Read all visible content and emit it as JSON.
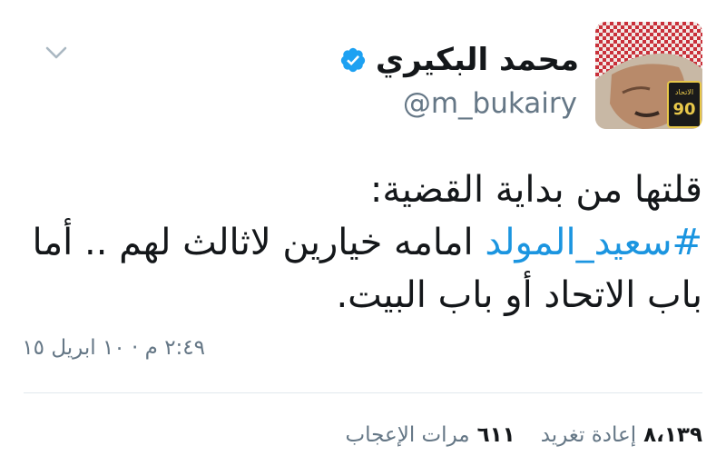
{
  "user": {
    "display_name": "محمد البكيري",
    "handle": "@m_bukairy",
    "verified": true,
    "avatar_badge": "90"
  },
  "tweet": {
    "line1": "قلتها من بداية القضية:",
    "hashtag": "#سعيد_المولد",
    "line2_rest": " امامه خيارين لاثالث لهم .. أما",
    "line3": "باب الاتحاد أو باب البيت.",
    "timestamp": "٢:٤٩ م · ١٠ ابريل ١٥"
  },
  "stats": {
    "retweets_count": "٨،١٣٩",
    "retweets_label": "إعادة تغريد",
    "likes_count": "٦١١",
    "likes_label": "مرات الإعجاب"
  },
  "colors": {
    "link": "#1b95e0",
    "secondary": "#657786",
    "verified": "#1da1f2"
  },
  "icons": {
    "menu": "chevron-down-icon",
    "verified": "verified-badge-icon"
  }
}
